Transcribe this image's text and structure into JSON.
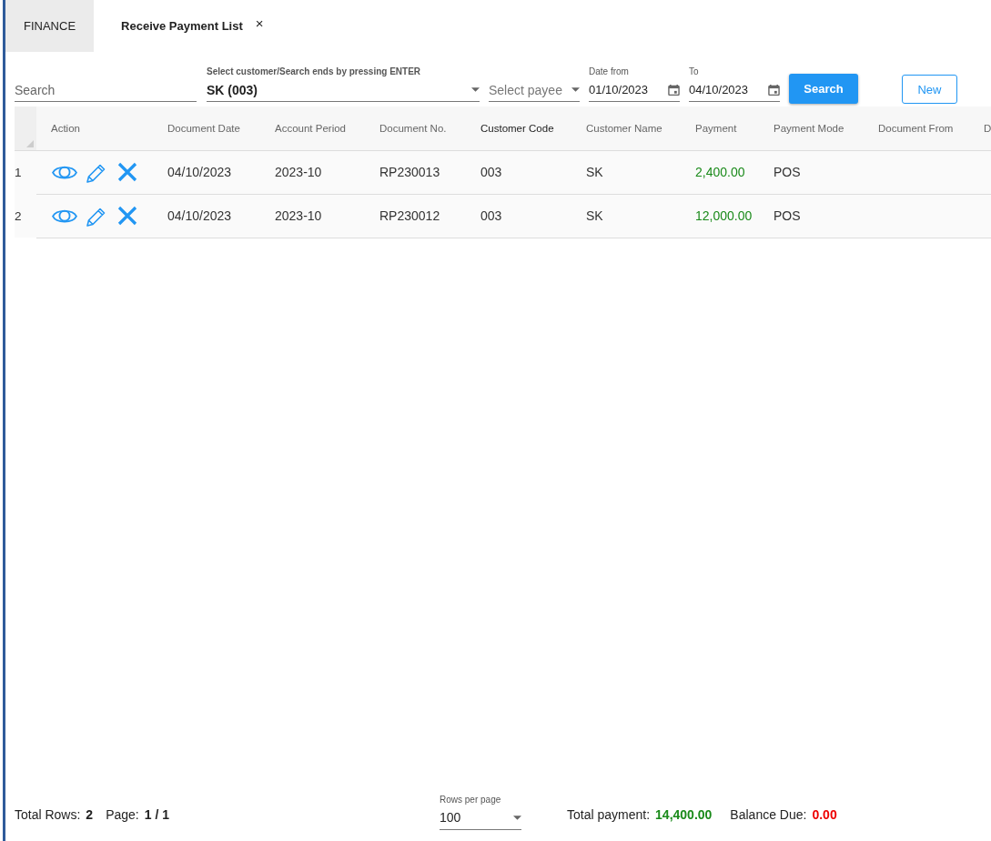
{
  "tabs": [
    {
      "label": "FINANCE",
      "selected": false,
      "closable": false
    },
    {
      "label": "Receive Payment List",
      "selected": true,
      "closable": true,
      "close_label": "×"
    }
  ],
  "filters": {
    "search": {
      "placeholder": "Search"
    },
    "customer": {
      "label": "Select customer/Search ends by pressing ENTER",
      "value": "SK (003)"
    },
    "payee": {
      "placeholder": "Select payee"
    },
    "date_from": {
      "label": "Date from",
      "value": "01/10/2023"
    },
    "date_to": {
      "label": "To",
      "value": "04/10/2023"
    },
    "search_button": "Search",
    "new_button": "New"
  },
  "table": {
    "action_column": "Action",
    "columns": [
      {
        "label": "Document Date",
        "sorted": false,
        "kind": "text"
      },
      {
        "label": "Account Period",
        "sorted": false,
        "kind": "text"
      },
      {
        "label": "Document No.",
        "sorted": false,
        "kind": "text"
      },
      {
        "label": "Customer Code",
        "sorted": true,
        "kind": "text"
      },
      {
        "label": "Customer Name",
        "sorted": false,
        "kind": "text"
      },
      {
        "label": "Payment",
        "sorted": false,
        "kind": "money"
      },
      {
        "label": "Payment Mode",
        "sorted": false,
        "kind": "text"
      },
      {
        "label": "Document From",
        "sorted": false,
        "kind": "text"
      },
      {
        "label": "D",
        "sorted": false,
        "kind": "text"
      }
    ],
    "rows": [
      {
        "number": "1",
        "cells": [
          "04/10/2023",
          "2023-10",
          "RP230013",
          "003",
          "SK",
          "2,400.00",
          "POS"
        ]
      },
      {
        "number": "2",
        "cells": [
          "04/10/2023",
          "2023-10",
          "RP230012",
          "003",
          "SK",
          "12,000.00",
          "POS"
        ]
      }
    ]
  },
  "footer": {
    "total_rows_label": "Total Rows:",
    "total_rows": "2",
    "page_label": "Page:",
    "page": "1 / 1",
    "rows_per_page_label": "Rows per page",
    "rows_per_page": "100",
    "total_payment_label": "Total payment:",
    "total_payment": "14,400.00",
    "balance_due_label": "Balance Due:",
    "balance_due": "0.00"
  }
}
